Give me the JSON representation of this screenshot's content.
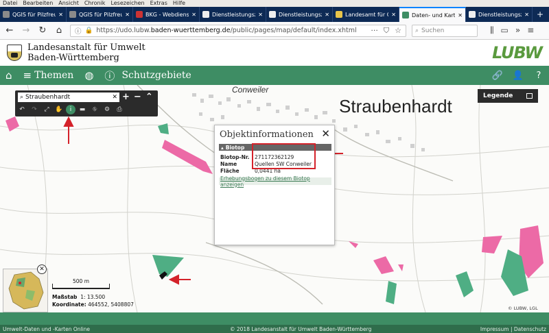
{
  "browser": {
    "menu": [
      "Datei",
      "Bearbeiten",
      "Ansicht",
      "Chronik",
      "Lesezeichen",
      "Extras",
      "Hilfe"
    ],
    "tabs": [
      {
        "label": "QGIS für Pilzfreund"
      },
      {
        "label": "QGIS für Pilzfreund"
      },
      {
        "label": "BKG - Webdienste"
      },
      {
        "label": "Dienstleistungszentr"
      },
      {
        "label": "Dienstleistungszentr"
      },
      {
        "label": "Landesamt für Geoi"
      },
      {
        "label": "Daten- und Karten"
      },
      {
        "label": "Dienstleistungszent"
      }
    ],
    "url_prefix": "https://udo.lubw.",
    "url_domain": "baden-wuerttemberg.de",
    "url_path": "/public/pages/map/default/index.xhtml",
    "search_placeholder": "Suchen"
  },
  "site": {
    "org_line1": "Landesanstalt für Umwelt",
    "org_line2": "Baden-Württemberg",
    "logo": "LUBW"
  },
  "toolbar": {
    "themen_label": "Themen",
    "schutzgebiete_label": "Schutzgebiete"
  },
  "map": {
    "place_big": "Straubenhardt",
    "place_small": "Conweiler",
    "search_value": "Straubenhardt",
    "legend_label": "Legende",
    "scale_label": "500 m",
    "massstab_label": "Maßstab",
    "massstab_value": "1: 13.500",
    "koordinate_label": "Koordinate:",
    "koordinate_value": "464552, 5408807",
    "credit": "© LUBW, LGL"
  },
  "popup": {
    "title": "Objektinformationen",
    "section": "Biotop",
    "rows": [
      {
        "key": "Biotop-Nr.",
        "value": "271172362129"
      },
      {
        "key": "Name",
        "value": "Quellen SW Conweiler"
      },
      {
        "key": "Fläche",
        "value": "0,0441 ha"
      }
    ],
    "link": "Erhebungsbogen zu diesem Biotop anzeigen"
  },
  "footer": {
    "left": "Umwelt-Daten und -Karten Online",
    "center": "© 2018 Landesanstalt für Umwelt Baden-Württemberg",
    "right": "Impressum | Datenschutz"
  },
  "colors": {
    "accent_green": "#3e8d64",
    "biotop_pink": "#ec6aa6",
    "biotop_green": "#4fae84",
    "annotation_red": "#d4222a"
  }
}
